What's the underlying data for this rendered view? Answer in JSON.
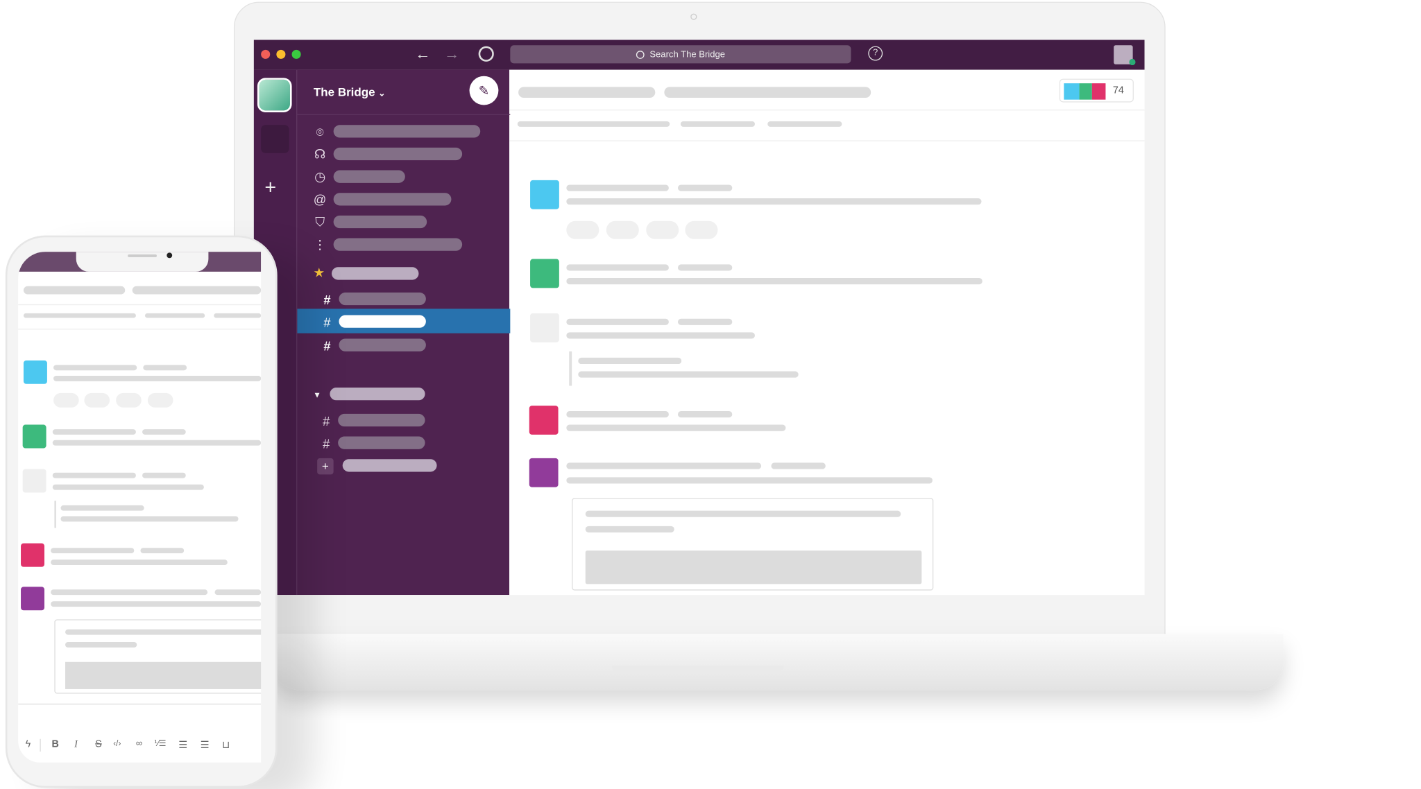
{
  "workspace": {
    "name": "The Bridge",
    "chevron": "⌄"
  },
  "search": {
    "placeholder": "Search The Bridge"
  },
  "header": {
    "member_count": "74"
  },
  "colors": {
    "titlebar": "#421d44",
    "sidebar": "#4f2350",
    "selected": "#2872ae",
    "cyan": "#4cc8f0",
    "green": "#3dba7d",
    "pink": "#e0326a",
    "purple": "#913b9a",
    "placeholder": "#dcdcdc"
  },
  "sidebar": {
    "icons": [
      "threads-icon",
      "huddle-icon",
      "activity-icon",
      "mentions-icon",
      "bookmark-icon",
      "more-icon"
    ]
  },
  "composer": {
    "toolbar": [
      "shortcut-icon",
      "bold-icon",
      "italic-icon",
      "strikethrough-icon",
      "code-icon",
      "link-icon",
      "ordered-list-icon",
      "bullet-list-icon",
      "blockquote-icon",
      "code-block-icon"
    ],
    "glyphs": [
      "ϟ",
      "B",
      "I",
      "S",
      "‹/›",
      "🔗",
      "⅟☰",
      "⁝☰",
      "|☰",
      "⌐"
    ]
  }
}
